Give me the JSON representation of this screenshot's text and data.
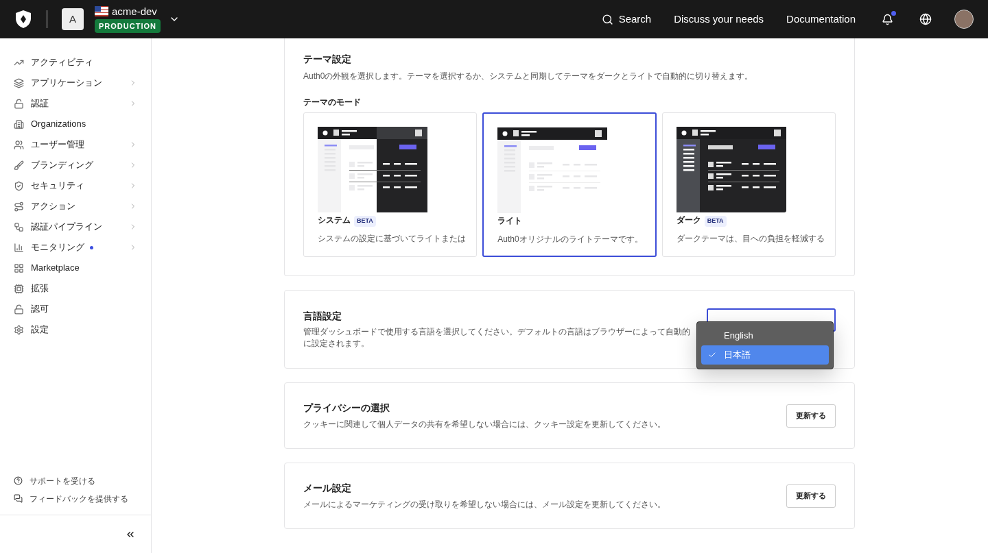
{
  "header": {
    "tenant_initial": "A",
    "tenant_name": "acme-dev",
    "environment": "PRODUCTION",
    "search": "Search",
    "links": [
      "Discuss your needs",
      "Documentation"
    ],
    "notifications_unread": true
  },
  "sidebar": {
    "items": [
      {
        "label": "アクティビティ",
        "has_submenu": false,
        "dot": false
      },
      {
        "label": "アプリケーション",
        "has_submenu": true,
        "dot": false
      },
      {
        "label": "認証",
        "has_submenu": true,
        "dot": false
      },
      {
        "label": "Organizations",
        "has_submenu": false,
        "dot": false
      },
      {
        "label": "ユーザー管理",
        "has_submenu": true,
        "dot": false
      },
      {
        "label": "ブランディング",
        "has_submenu": true,
        "dot": false
      },
      {
        "label": "セキュリティ",
        "has_submenu": true,
        "dot": false
      },
      {
        "label": "アクション",
        "has_submenu": true,
        "dot": false
      },
      {
        "label": "認証パイプライン",
        "has_submenu": true,
        "dot": false
      },
      {
        "label": "モニタリング",
        "has_submenu": true,
        "dot": true
      },
      {
        "label": "Marketplace",
        "has_submenu": false,
        "dot": false
      },
      {
        "label": "拡張",
        "has_submenu": false,
        "dot": false
      },
      {
        "label": "認可",
        "has_submenu": false,
        "dot": false
      },
      {
        "label": "設定",
        "has_submenu": false,
        "dot": false
      }
    ],
    "footer": [
      {
        "label": "サポートを受ける"
      },
      {
        "label": "フィードバックを提供する"
      }
    ]
  },
  "theme": {
    "title": "テーマ設定",
    "description": "Auth0の外観を選択します。テーマを選択するか、システムと同期してテーマをダークとライトで自動的に切り替えます。",
    "mode_label": "テーマのモード",
    "options": [
      {
        "kind": "system",
        "name": "システム",
        "badge": "BETA",
        "description": "システムの設定に基づいてライトまたは",
        "selected": false
      },
      {
        "kind": "light",
        "name": "ライト",
        "description": "Auth0オリジナルのライトテーマです。",
        "selected": true
      },
      {
        "kind": "dark",
        "name": "ダーク",
        "badge": "BETA",
        "description": "ダークテーマは、目への負担を軽減する",
        "selected": false
      }
    ]
  },
  "language": {
    "title": "言語設定",
    "description": "管理ダッシュボードで使用する言語を選択してください。デフォルトの言語はブラウザーによって自動的に設定されます。",
    "options": [
      {
        "label": "English",
        "selected": false
      },
      {
        "label": "日本語",
        "selected": true
      }
    ]
  },
  "privacy": {
    "title": "プライバシーの選択",
    "description": "クッキーに関連して個人データの共有を希望しない場合には、クッキー設定を更新してください。",
    "button": "更新する"
  },
  "email": {
    "title": "メール設定",
    "description": "メールによるマーケティングの受け取りを希望しない場合には、メール設定を更新してください。",
    "button": "更新する"
  }
}
